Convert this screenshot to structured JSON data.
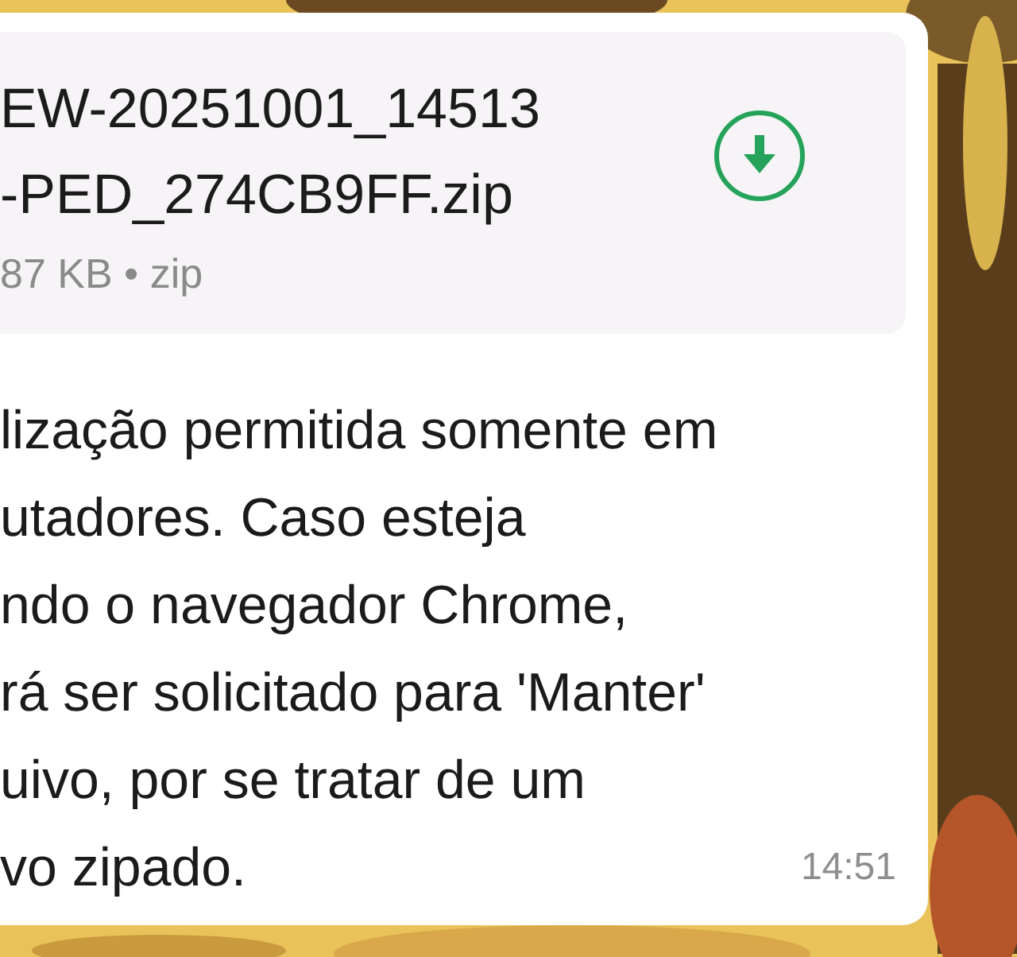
{
  "file": {
    "name_lines": [
      "EW-20251001_14513",
      "-PED_274CB9FF.zip"
    ],
    "meta": "87 KB • zip"
  },
  "message": {
    "lines": [
      "lização permitida somente em",
      "utadores. Caso esteja",
      "ndo o navegador Chrome,",
      "rá ser solicitado para 'Manter'",
      "uivo, por se tratar de um",
      "vo zipado."
    ],
    "time": "14:51"
  }
}
